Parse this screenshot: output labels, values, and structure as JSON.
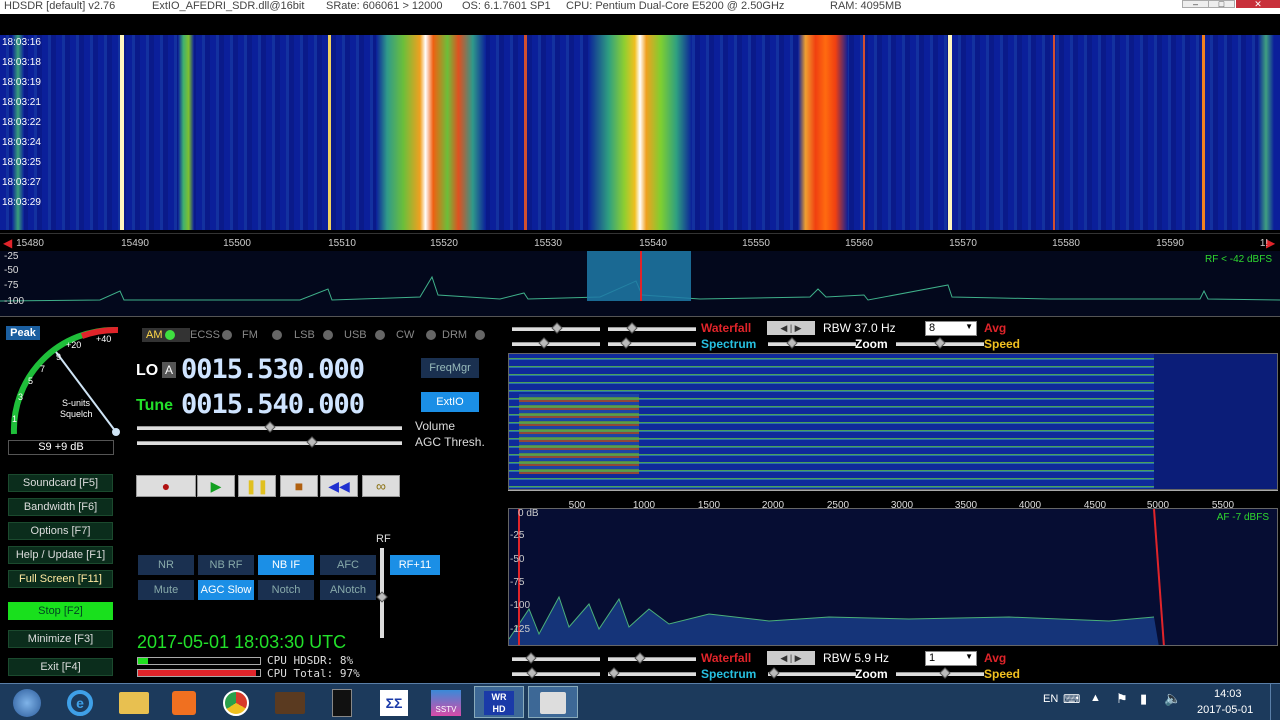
{
  "titlebar": {
    "segments": [
      "HDSDR  [default]  v2.76",
      "ExtIO_AFEDRI_SDR.dll@16bit",
      "SRate: 606061 > 12000",
      "OS: 6.1.7601 SP1",
      "CPU: Pentium Dual-Core       E5200  @ 2.50GHz",
      "RAM: 4095MB"
    ]
  },
  "waterfall": {
    "timestamps": [
      "18:03:16",
      "18:03:18",
      "18:03:19",
      "18:03:21",
      "18:03:22",
      "18:03:24",
      "18:03:25",
      "18:03:27",
      "18:03:29"
    ],
    "freq_ticks": [
      "15480",
      "15490",
      "15500",
      "15510",
      "15520",
      "15530",
      "15540",
      "15550",
      "15560",
      "15570",
      "15580",
      "15590",
      "1!"
    ]
  },
  "spectrum": {
    "db_labels": [
      "-25",
      "-50",
      "-75",
      "-100"
    ],
    "rf_dbfs": "RF < -42 dBFS"
  },
  "smeter": {
    "peak_label": "Peak",
    "scale": [
      "1",
      "3",
      "5",
      "7",
      "9",
      "+20",
      "+40"
    ],
    "caption1": "S-units",
    "caption2": "Squelch",
    "reading": "S9 +9 dB"
  },
  "modes": [
    "AM",
    "ECSS",
    "FM",
    "LSB",
    "USB",
    "CW",
    "DRM"
  ],
  "lo": {
    "label": "LO",
    "sub": "A",
    "value": "0015.530.000"
  },
  "tune": {
    "label": "Tune",
    "value": "0015.540.000"
  },
  "buttons": {
    "freqmgr": "FreqMgr",
    "extio": "ExtIO",
    "volume": "Volume",
    "agc_thresh": "AGC Thresh.",
    "rf": "RF",
    "rf11": "RF+11"
  },
  "dsp": [
    "NR",
    "NB RF",
    "NB IF",
    "AFC",
    "Mute",
    "AGC Slow",
    "Notch",
    "ANotch"
  ],
  "side": [
    "Soundcard  [F5]",
    "Bandwidth  [F6]",
    "Options  [F7]",
    "Help / Update  [F1]",
    "Full Screen  [F11]",
    "Stop  [F2]",
    "Minimize  [F3]",
    "Exit  [F4]"
  ],
  "status": {
    "datetime": "2017-05-01   18:03:30 UTC",
    "cpu_hdsdr": "CPU HDSDR: 8%",
    "cpu_total": "CPU Total: 97%",
    "cpu_hdsdr_level": 0.08,
    "cpu_total_level": 0.97
  },
  "rightpanel": {
    "waterfall": "Waterfall",
    "spectrum": "Spectrum",
    "rbw_top": "RBW 37.0 Hz",
    "zoom": "Zoom",
    "avg": "Avg",
    "speed": "Speed",
    "sel_top": "8",
    "rbw_bottom": "RBW  5.9 Hz",
    "sel_bottom": "1",
    "af_ticks": [
      "500",
      "1000",
      "1500",
      "2000",
      "2500",
      "3000",
      "3500",
      "4000",
      "4500",
      "5000",
      "5500"
    ],
    "af_db": [
      "0 dB",
      "-25",
      "-50",
      "-75",
      "-100",
      "-125"
    ],
    "af_dbfs": "AF -7 dBFS"
  },
  "taskbar": {
    "lang": "EN",
    "time": "14:03",
    "date": "2017-05-01"
  },
  "colors": {
    "accent": "#1b8fe6",
    "stop_green": "#19e01d",
    "waterfall_bg": "#0a1f9e",
    "alert_red": "#e0242a",
    "spectrum_cyan": "#27c0e0"
  }
}
